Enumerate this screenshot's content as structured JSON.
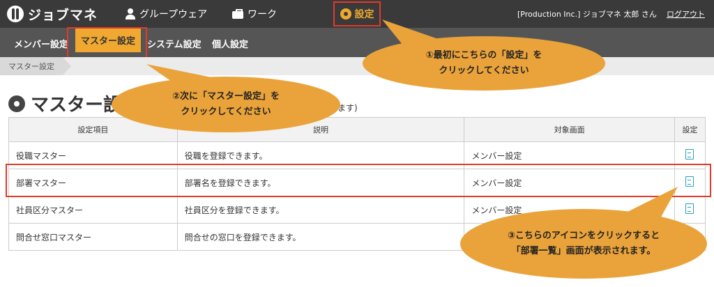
{
  "header": {
    "logo": "ジョブマネ",
    "nav": [
      {
        "label": "グループウェア"
      },
      {
        "label": "ワーク"
      }
    ],
    "settings_label": "設定",
    "user": "[Production Inc.] ジョブマネ 太郎 さん",
    "logout": "ログアウト"
  },
  "subnav": {
    "items": [
      "メンバー設定",
      "マスター設定",
      "システム設定",
      "個人設定"
    ]
  },
  "breadcrumb": "マスター設定",
  "page": {
    "title": "マスター設",
    "note": "ます)"
  },
  "table": {
    "headers": [
      "設定項目",
      "説明",
      "対象画面",
      "設定"
    ],
    "rows": [
      {
        "item": "役職マスター",
        "desc": "役職を登録できます。",
        "target": "メンバー設定"
      },
      {
        "item": "部署マスター",
        "desc": "部署名を登録できます。",
        "target": "メンバー設定"
      },
      {
        "item": "社員区分マスター",
        "desc": "社員区分を登録できます。",
        "target": "メンバー設定"
      },
      {
        "item": "問合せ窓口マスター",
        "desc": "問合せの窓口を登録できます。",
        "target": ""
      }
    ]
  },
  "callouts": [
    {
      "line1": "①最初にこちらの「設定」を",
      "line2": "クリックしてください"
    },
    {
      "line1": "②次に「マスター設定」を",
      "line2": "クリックしてください"
    },
    {
      "line1": "③こちらのアイコンをクリックすると",
      "line2": "「部署一覧」画面が表示されます。"
    }
  ],
  "colors": {
    "accent": "#f0a830",
    "highlight": "#e23a2a",
    "callout": "#eaa33a",
    "icon": "#2aa0b8"
  }
}
